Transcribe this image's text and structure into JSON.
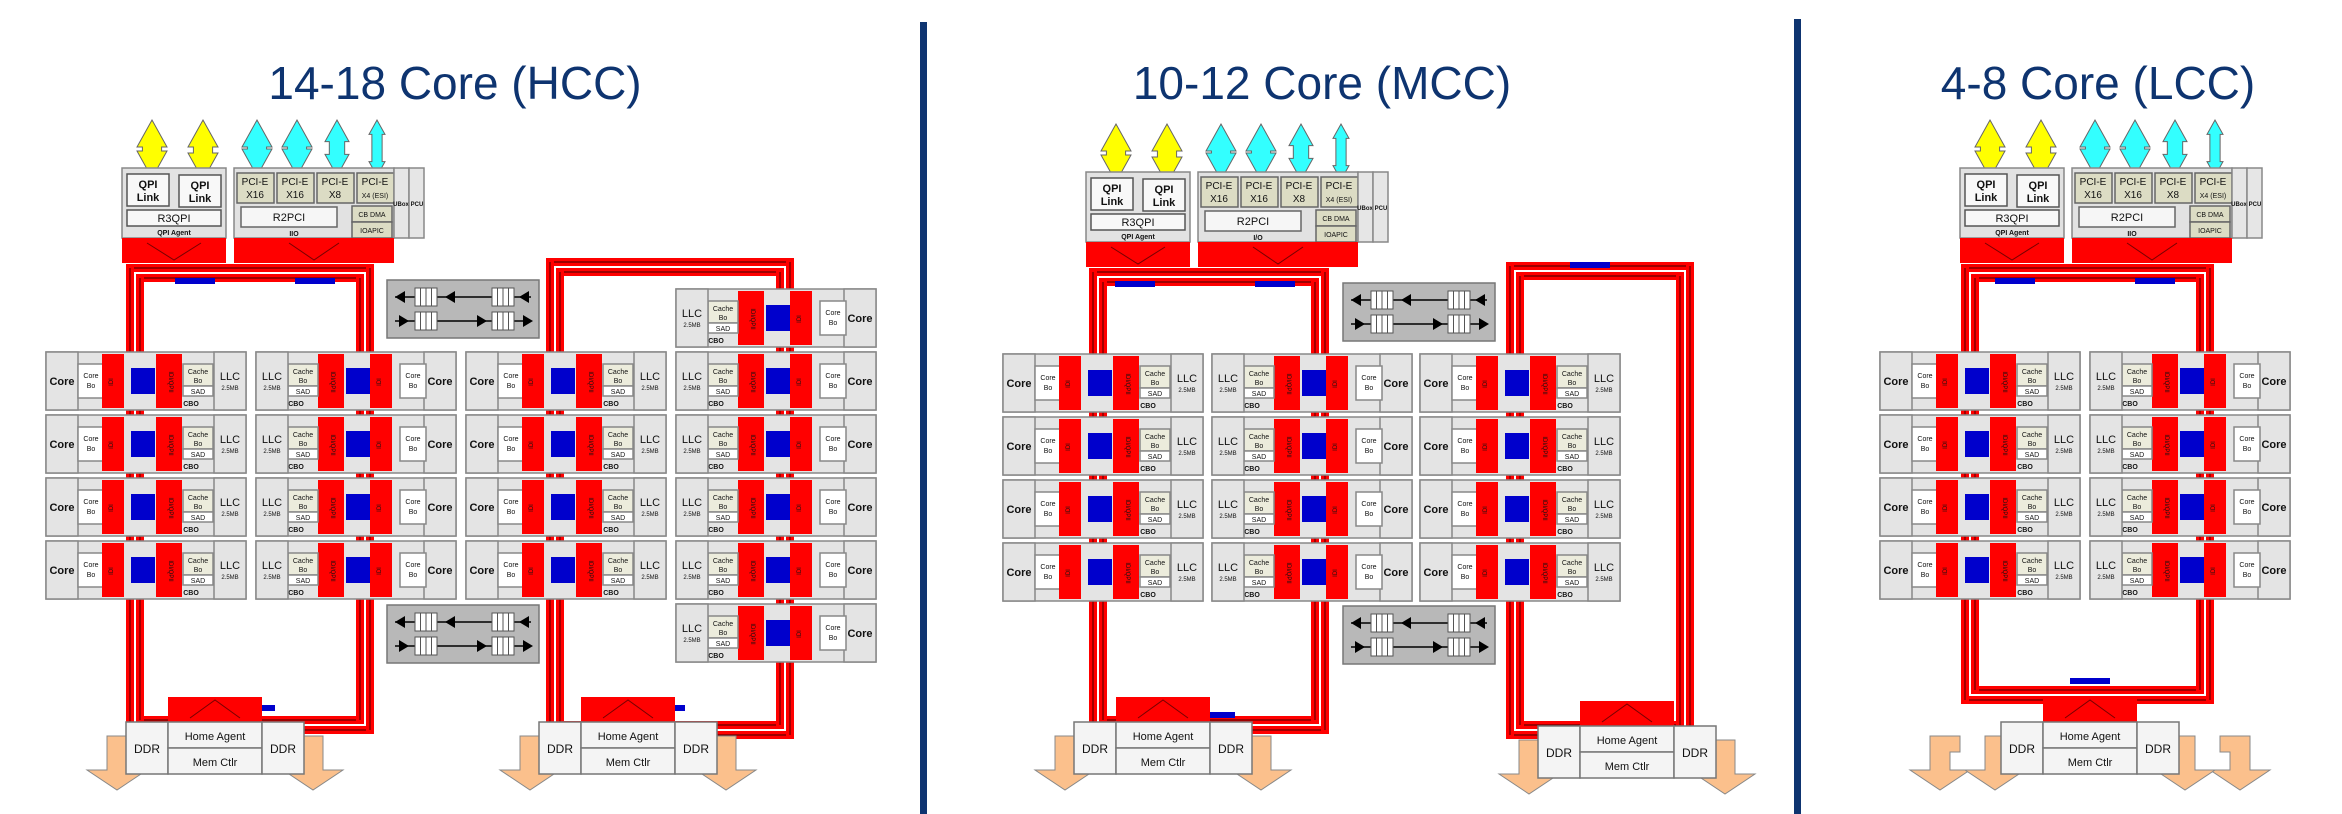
{
  "panels": [
    {
      "id": "hcc",
      "title": "14-18 Core (HCC)",
      "ring_count": 2,
      "tile_grid": "4 rows x 4 columns plus 2 extra tiles in rightmost column",
      "home_agents": 2,
      "ddr_arrows_per_side": 1
    },
    {
      "id": "mcc",
      "title": "10-12 Core (MCC)",
      "ring_count": 2,
      "tile_grid": "4 rows x 3 columns",
      "home_agents": 2,
      "ddr_arrows_per_side": 1
    },
    {
      "id": "lcc",
      "title": "4-8 Core (LCC)",
      "ring_count": 1,
      "tile_grid": "4 rows x 2 columns",
      "home_agents": 1,
      "ddr_arrows_per_side": 2
    }
  ],
  "io_block": {
    "qpi_link": "QPI",
    "qpi_link_2": "Link",
    "r3qpi": "R3QPI",
    "qpi_agent": "QPI Agent",
    "pcie": "PCI-E",
    "pcie_lanes": [
      "X16",
      "X16",
      "X8",
      "X4 (ESI)"
    ],
    "r2pci": "R2PCI",
    "cb_dma": "CB DMA",
    "ioapic": "IOAPIC",
    "iio": "IIO",
    "iio_mcc": "I/O",
    "ubox": "UBox",
    "pcu": "PCU"
  },
  "tile": {
    "core": "Core",
    "core_bo_1": "Core",
    "core_bo_2": "Bo",
    "idi": "IDI",
    "idi_qpii": "IDI/QPII",
    "cache_bo_1": "Cache",
    "cache_bo_2": "Bo",
    "sad": "SAD",
    "cbo": "CBO",
    "llc": "LLC",
    "llc_size": "2.5MB"
  },
  "memory": {
    "ddr": "DDR",
    "home_agent": "Home Agent",
    "mem_ctlr": "Mem Ctlr"
  },
  "colors": {
    "title": "#0e3470",
    "ring": "#ff0000",
    "ring_stop": "#0000cc",
    "qpi_arrow": "#ffff00",
    "pcie_arrow": "#33ffff",
    "ddr_arrow": "#fbc08c",
    "tile_bg": "#e4e4e4",
    "cache_bg": "#ececdc",
    "switch_bg": "#b8b8b8"
  }
}
